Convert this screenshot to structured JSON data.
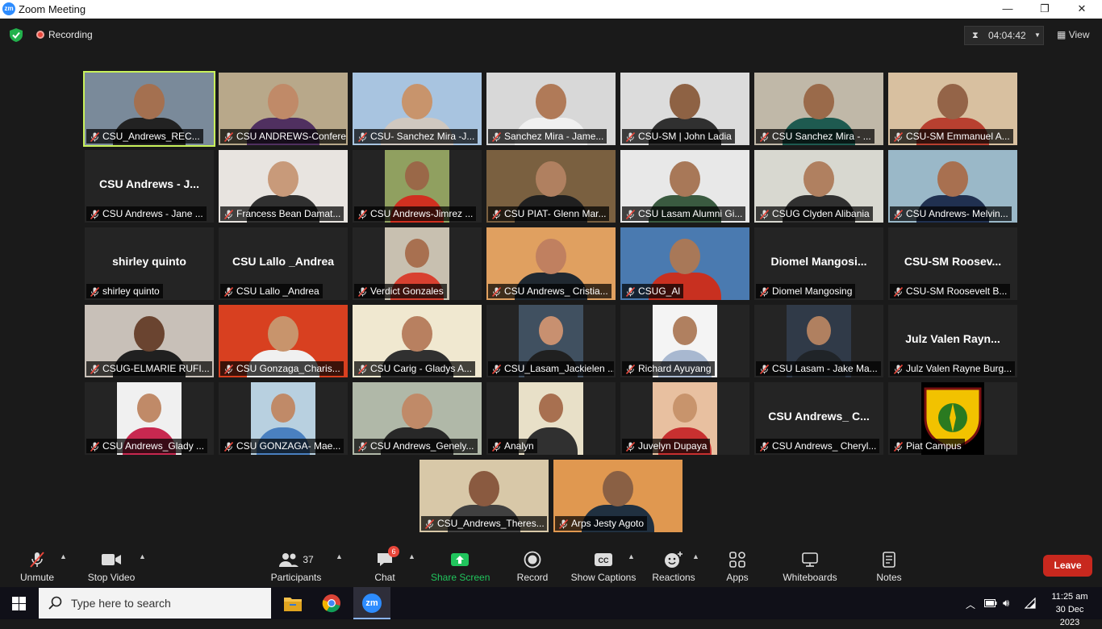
{
  "window": {
    "app_icon": "zm",
    "title": "Zoom Meeting",
    "minimize": "—",
    "maximize": "❐",
    "close": "✕"
  },
  "topbar": {
    "recording_label": "Recording",
    "timer": "04:04:42",
    "view_label": "View"
  },
  "participants_grid": [
    {
      "name": "CSU_Andrews_REC...",
      "big": "",
      "active": true,
      "photo": "#7a8a9a",
      "skin": "#a47050",
      "shirt": "#222"
    },
    {
      "name": "CSU ANDREWS-Confere...",
      "big": "",
      "photo": "#b8a88a",
      "skin": "#c08a68",
      "shirt": "#503060"
    },
    {
      "name": "CSU- Sanchez Mira -J...",
      "big": "",
      "photo": "#a8c4e0",
      "skin": "#c8946c",
      "shirt": "#d0c8c0"
    },
    {
      "name": "Sanchez Mira - Jame...",
      "big": "",
      "photo": "#d8d8d8",
      "skin": "#b07a58",
      "shirt": "#f0f0f0"
    },
    {
      "name": "CSU-SM | John Ladia",
      "big": "",
      "photo": "#dcdcdc",
      "skin": "#8e6244",
      "shirt": "#303030"
    },
    {
      "name": "CSU Sanchez Mira - ...",
      "big": "",
      "photo": "#c0b8a8",
      "skin": "#9a6a4a",
      "shirt": "#1e5a50"
    },
    {
      "name": "CSU-SM Emmanuel A...",
      "big": "",
      "photo": "#d8c0a0",
      "skin": "#946448",
      "shirt": "#b84030"
    },
    {
      "name": "CSU Andrews - Jane ...",
      "big": "CSU Andrews - J...",
      "photo": "",
      "skin": "",
      "shirt": ""
    },
    {
      "name": "Francess Bean Damat...",
      "big": "",
      "photo": "#e8e4e0",
      "skin": "#c89a7a",
      "shirt": "#303030"
    },
    {
      "name": "CSU Andrews-Jimrez ...",
      "big": "",
      "photo": "#90a060",
      "skin": "#9a6848",
      "shirt": "#d03020"
    },
    {
      "name": "CSU PIAT- Glenn Mar...",
      "big": "",
      "photo": "#7a6040",
      "skin": "#b08060",
      "shirt": "#202020"
    },
    {
      "name": "CSU Lasam Alumni Gi...",
      "big": "",
      "photo": "#e8e8e8",
      "skin": "#a87858",
      "shirt": "#3a5a40"
    },
    {
      "name": "CSUG Clyden Alibania",
      "big": "",
      "photo": "#d8d8d0",
      "skin": "#b08060",
      "shirt": "#303030"
    },
    {
      "name": "CSU Andrews- Melvin...",
      "big": "",
      "photo": "#9ab8c8",
      "skin": "#a87050",
      "shirt": "#203050"
    },
    {
      "name": "shirley quinto",
      "big": "shirley quinto",
      "photo": "",
      "skin": "",
      "shirt": ""
    },
    {
      "name": "CSU Lallo _Andrea",
      "big": "CSU Lallo _Andrea",
      "photo": "",
      "skin": "",
      "shirt": ""
    },
    {
      "name": "Verdict Gonzales",
      "big": "",
      "photo": "#c8c0b0",
      "skin": "#a87050",
      "shirt": "#d84030"
    },
    {
      "name": "CSU Andrews_ Cristia...",
      "big": "",
      "photo": "#e0a060",
      "skin": "#c08060",
      "shirt": "#202830"
    },
    {
      "name": "CSUG_Al",
      "big": "",
      "photo": "#4a7ab0",
      "skin": "#a87858",
      "shirt": "#c83020"
    },
    {
      "name": "Diomel Mangosing",
      "big": "Diomel  Mangosi...",
      "photo": "",
      "skin": "",
      "shirt": ""
    },
    {
      "name": "CSU-SM Roosevelt B...",
      "big": "CSU-SM  Roosev...",
      "photo": "",
      "skin": "",
      "shirt": ""
    },
    {
      "name": "CSUG-ELMARIE RUFI...",
      "big": "",
      "photo": "#c8c0b8",
      "skin": "#6a4430",
      "shirt": "#202020"
    },
    {
      "name": "CSU Gonzaga_Charis...",
      "big": "",
      "photo": "#d84020",
      "skin": "#c8946c",
      "shirt": "#f0f0f0"
    },
    {
      "name": "CSU Carig - Gladys A...",
      "big": "",
      "photo": "#f0e8d0",
      "skin": "#b88060",
      "shirt": "#303030"
    },
    {
      "name": "CSU_Lasam_Jackielen ...",
      "big": "",
      "photo": "#405060",
      "skin": "#c89070",
      "shirt": "#202020"
    },
    {
      "name": "Richard Ayuyang",
      "big": "",
      "photo": "#f4f4f4",
      "skin": "#b08060",
      "shirt": "#a8b8d0"
    },
    {
      "name": "CSU Lasam - Jake Ma...",
      "big": "",
      "photo": "#303a48",
      "skin": "#b08060",
      "shirt": "#202428"
    },
    {
      "name": "Julz Valen Rayne Burg...",
      "big": "Julz Valen  Rayn...",
      "photo": "",
      "skin": "",
      "shirt": ""
    },
    {
      "name": "CSU Andrews_Glady ...",
      "big": "",
      "photo": "#f0f0f0",
      "skin": "#c08a68",
      "shirt": "#c82850"
    },
    {
      "name": "CSU GONZAGA- Mae...",
      "big": "",
      "photo": "#b8d0e0",
      "skin": "#c08a68",
      "shirt": "#4a80c0"
    },
    {
      "name": "CSU Andrews_Genely...",
      "big": "",
      "photo": "#b0b8a8",
      "skin": "#c08a68",
      "shirt": "#282828"
    },
    {
      "name": "Analyn",
      "big": "",
      "photo": "#e8e0c8",
      "skin": "#a87050",
      "shirt": "#303030"
    },
    {
      "name": "Juvelyn Dupaya",
      "big": "",
      "photo": "#e8c0a0",
      "skin": "#c8946c",
      "shirt": "#c83030"
    },
    {
      "name": "CSU Andrews_ Cheryl...",
      "big": "CSU Andrews_  C...",
      "photo": "",
      "skin": "",
      "shirt": ""
    },
    {
      "name": "Piat Campus",
      "big": "",
      "photo": "#000",
      "skin": "",
      "shirt": "",
      "logo": true
    },
    {
      "name": "CSU_Andrews_Theres...",
      "big": "",
      "photo": "#d8c8a8",
      "skin": "#8a5a40",
      "shirt": "#404040"
    },
    {
      "name": "Arps Jesty Agoto",
      "big": "",
      "photo": "#e09850",
      "skin": "#8a6044",
      "shirt": "#203040"
    }
  ],
  "toolbar": {
    "unmute": "Unmute",
    "stop_video": "Stop Video",
    "participants": "Participants",
    "participants_count": "37",
    "chat": "Chat",
    "chat_badge": "6",
    "share_screen": "Share Screen",
    "record": "Record",
    "show_captions": "Show Captions",
    "reactions": "Reactions",
    "apps": "Apps",
    "whiteboards": "Whiteboards",
    "notes": "Notes",
    "leave": "Leave"
  },
  "taskbar": {
    "search_placeholder": "Type here to search",
    "time": "11:25 am",
    "date": "30 Dec 2023",
    "zoom_icon_label": "zm"
  },
  "colors": {
    "share_green": "#21c55d",
    "leave_red": "#c8281e",
    "active_speaker": "#c9f25b",
    "accent_blue": "#2d8cff"
  }
}
